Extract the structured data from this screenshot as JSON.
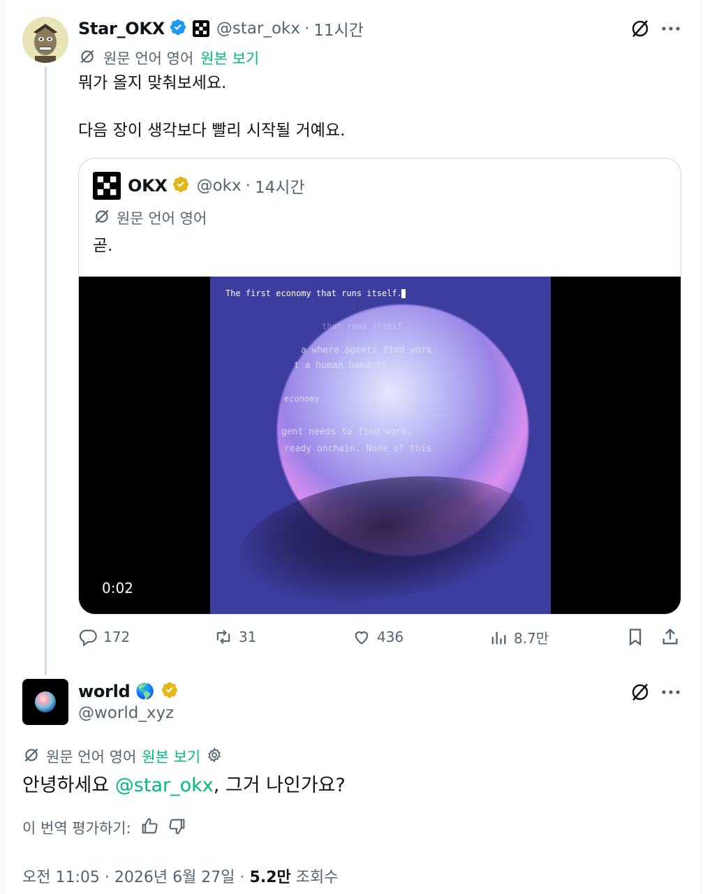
{
  "main_tweet": {
    "name": "Star_OKX",
    "handle": "@star_okx",
    "dot": "·",
    "time": "11시간",
    "translate_label": "원문 언어 영어",
    "show_original": "원본 보기",
    "text_line1": "뭐가 올지 맞춰보세요.",
    "text_line2": "다음 장이 생각보다 빨리 시작될 거예요."
  },
  "quoted_tweet": {
    "name": "OKX",
    "handle": "@okx",
    "dot": "·",
    "time": "14시간",
    "translate_label": "원문 언어 영어",
    "text": "곧.",
    "video": {
      "duration": "0:02",
      "caption": "The first economy that runs itself.",
      "overlay_lines": [
        "that runs itself.",
        "a where agents find work.",
        "t a human handoff.",
        "economy.",
        "gent needs to find work,",
        "ready onchain. None of this"
      ]
    }
  },
  "actions": {
    "replies": "172",
    "retweets": "31",
    "likes": "436",
    "views": "8.7만"
  },
  "reply": {
    "name": "world",
    "globe_emoji": "🌎",
    "handle": "@world_xyz",
    "translate_label": "원문 언어 영어",
    "show_original": "원본 보기",
    "text_pre": "안녕하세요 ",
    "mention": "@star_okx",
    "text_post": ", 그거 나인가요?",
    "rate_label": "이 번역 평가하기:",
    "timestamp": "오전 11:05 · 2026년 6월 27일 · ",
    "view_count": "5.2만",
    "view_label": " 조회수"
  },
  "colors": {
    "verified_blue": "#1d9bf0",
    "verified_gold": "#e2b719",
    "link_green": "#00ba7c",
    "muted": "#536471"
  }
}
